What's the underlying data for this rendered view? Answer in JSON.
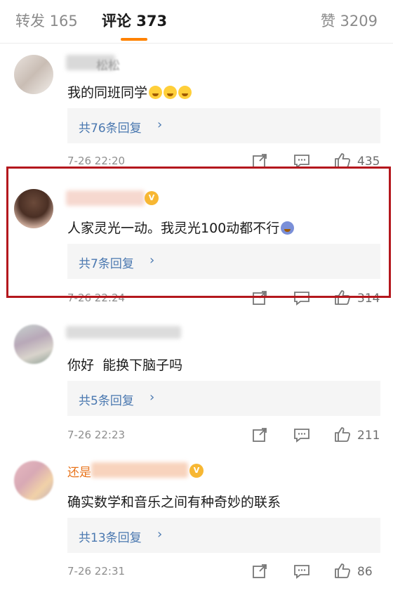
{
  "tabs": {
    "repost": "转发 165",
    "comment": "评论 373",
    "like": "赞 3209",
    "active_color": "#ff8200"
  },
  "comments": [
    {
      "name_visible": "松松",
      "text": "我的同班同学",
      "emojis": [
        "crying-emoji",
        "crying-emoji",
        "crying-emoji"
      ],
      "reply_label": "共76条回复",
      "time": "7-26 22:20",
      "likes": "435"
    },
    {
      "name_visible": "",
      "text": "人家灵光一动。我灵光100动都不行",
      "emojis": [
        "dizzy-emoji"
      ],
      "reply_label": "共7条回复",
      "time": "7-26 22:24",
      "likes": "314"
    },
    {
      "name_visible": "",
      "text": "你好  能换下脑子吗",
      "emojis": [],
      "reply_label": "共5条回复",
      "time": "7-26 22:23",
      "likes": "211"
    },
    {
      "name_visible": "还是",
      "text": "确实数学和音乐之间有种奇妙的联系",
      "emojis": [],
      "reply_label": "共13条回复",
      "time": "7-26 22:31",
      "likes": "86"
    }
  ],
  "reply_chevron": "›",
  "highlight_color": "#b4171d",
  "link_color": "#4a78b0"
}
